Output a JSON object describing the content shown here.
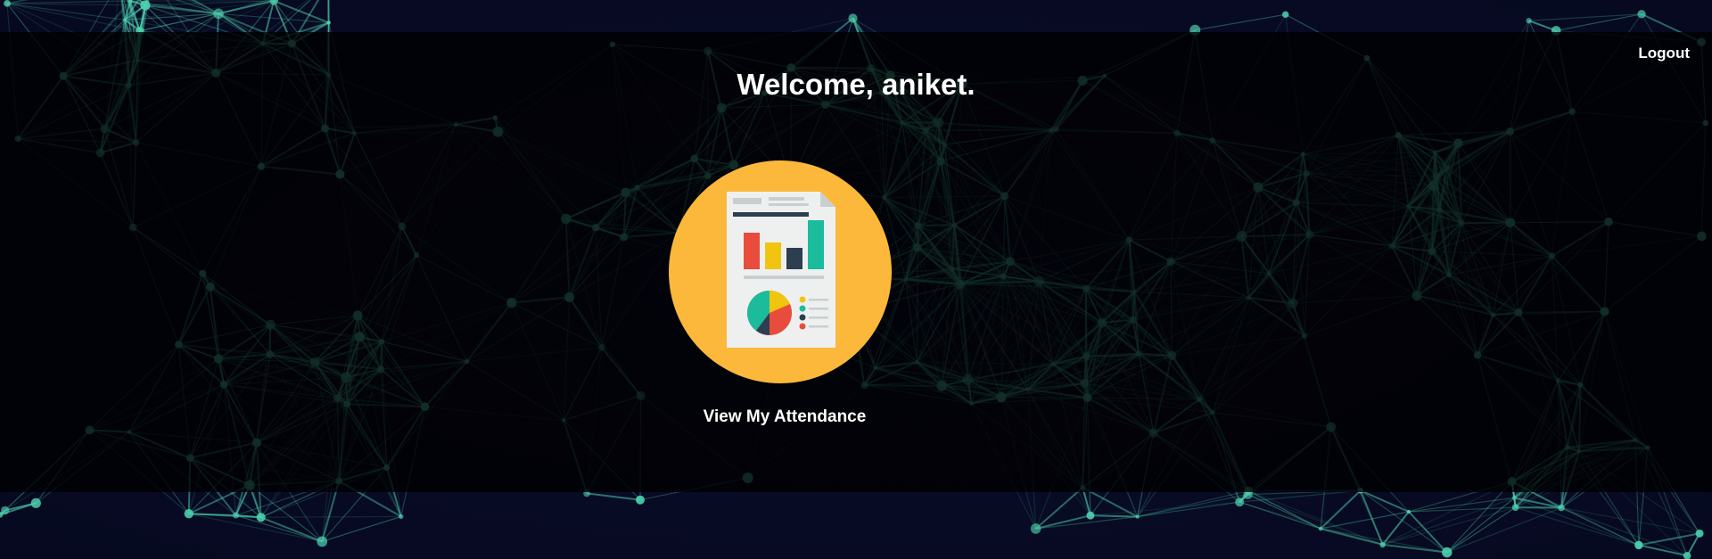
{
  "header": {
    "logout_label": "Logout"
  },
  "main": {
    "welcome_text": "Welcome, aniket.",
    "attendance_card": {
      "label": "View My Attendance",
      "icon": "report-chart-icon"
    }
  },
  "colors": {
    "network_line": "#4fd1b0",
    "icon_circle": "#fbb83b",
    "bar_red": "#e74c3c",
    "bar_yellow": "#f1c40f",
    "bar_navy": "#2c3e50",
    "bar_teal": "#1abc9c"
  }
}
